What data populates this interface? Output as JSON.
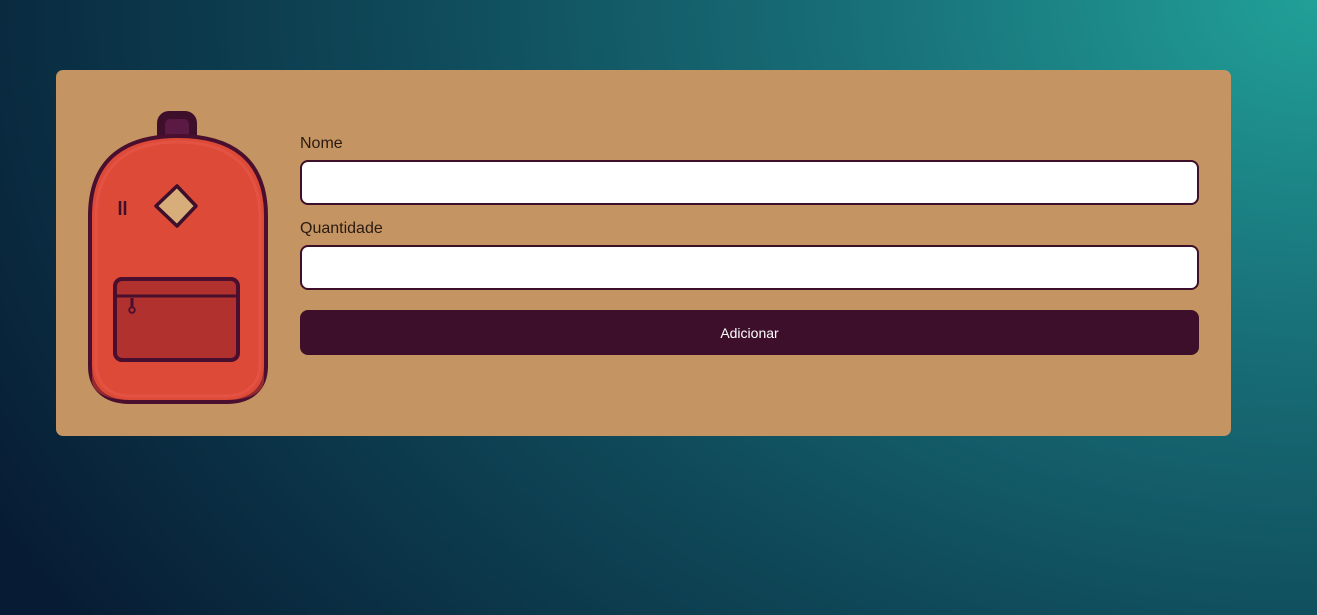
{
  "form": {
    "name_label": "Nome",
    "name_value": "",
    "name_placeholder": "",
    "quantity_label": "Quantidade",
    "quantity_value": "",
    "quantity_placeholder": "",
    "submit_label": "Adicionar"
  },
  "illustration": {
    "icon": "backpack-icon"
  },
  "colors": {
    "card_background": "#c49562",
    "accent": "#3d0f2b",
    "backpack_body": "#dd4a38",
    "backpack_pocket": "#b0312d"
  }
}
